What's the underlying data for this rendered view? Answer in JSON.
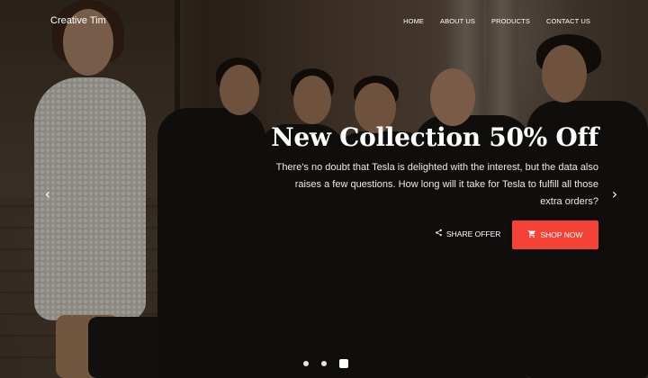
{
  "nav": {
    "brand": "Creative Tim",
    "menu": [
      {
        "label": "HOME"
      },
      {
        "label": "ABOUT US"
      },
      {
        "label": "PRODUCTS"
      },
      {
        "label": "CONTACT US"
      }
    ]
  },
  "hero": {
    "title": "New Collection 50% Off",
    "description": "There's no doubt that Tesla is delighted with the interest, but the data also raises a few questions. How long will it take for Tesla to fulfill all those extra orders?",
    "share_label": "SHARE OFFER",
    "shop_label": "SHOP NOW",
    "prev_icon": "chevron-left-icon",
    "next_icon": "chevron-right-icon",
    "accent_color": "#f44336"
  },
  "carousel": {
    "slide_count": 3,
    "active_index": 2
  }
}
